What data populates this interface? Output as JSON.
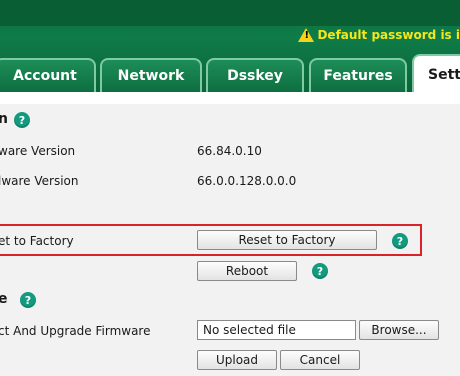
{
  "header": {
    "warning_text": "Default password is i",
    "warning_icon": "warning-triangle-icon"
  },
  "tabs": [
    {
      "label": "Account"
    },
    {
      "label": "Network"
    },
    {
      "label": "Dsskey"
    },
    {
      "label": "Features"
    },
    {
      "label": "Sett"
    }
  ],
  "version": {
    "title": "n",
    "firmware_label": "ware Version",
    "firmware_value": "66.84.0.10",
    "hardware_label": "lware Version",
    "hardware_value": "66.0.0.128.0.0.0"
  },
  "factory": {
    "label": "et to Factory",
    "button": "Reset to Factory"
  },
  "reboot": {
    "button": "Reboot"
  },
  "upgrade": {
    "title": "e",
    "label": "ct And Upgrade Firmware",
    "file_value": "No selected file",
    "browse_button": "Browse...",
    "upload_button": "Upload",
    "cancel_button": "Cancel"
  },
  "colors": {
    "header_green": "#0f7c48",
    "warning_yellow": "#f6e71a",
    "help_teal": "#129b7e",
    "highlight_red": "#d9232a"
  }
}
